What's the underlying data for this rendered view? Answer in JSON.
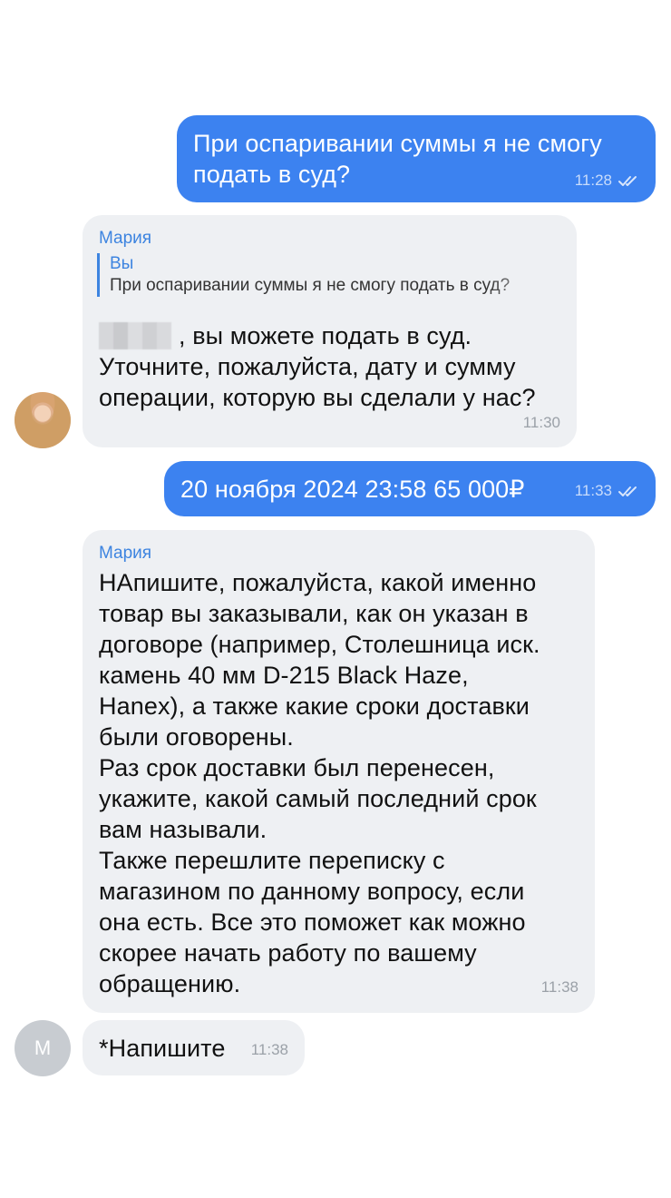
{
  "messages": [
    {
      "text": "При оспаривании суммы я не смогу\nподать в суд?",
      "time": "11:28"
    },
    {
      "sender": "Мария",
      "reply_name": "Вы",
      "reply_text": "При оспаривании суммы я не смогу подать в суд?",
      "text": ", вы можете подать в суд.\nУточните, пожалуйста, дату и сумму\nоперации, которую вы сделали у нас?",
      "time": "11:30"
    },
    {
      "text": "20 ноября 2024 23:58 65 000₽",
      "time": "11:33"
    },
    {
      "sender": "Мария",
      "text": "НАпишите, пожалуйста, какой именно\nтовар вы заказывали, как он указан в\nдоговоре (например, Столешница иск.\nкамень 40 мм D-215 Black Haze,\nHanex), а также какие сроки доставки\nбыли оговорены.\nРаз срок доставки был перенесен,\nукажите, какой самый последний срок\nвам называли.\nТакже перешлите переписку с\nмагазином по данному вопросу, если\nона есть. Все это поможет как можно\nскорее начать работу по вашему\nобращению.",
      "time": "11:38"
    },
    {
      "text": "*Напишите",
      "time": "11:38"
    }
  ],
  "avatar_letter": "М",
  "colors": {
    "outgoing": "#3c82f0",
    "incoming": "#eef0f3",
    "sender": "#3d84e0"
  }
}
